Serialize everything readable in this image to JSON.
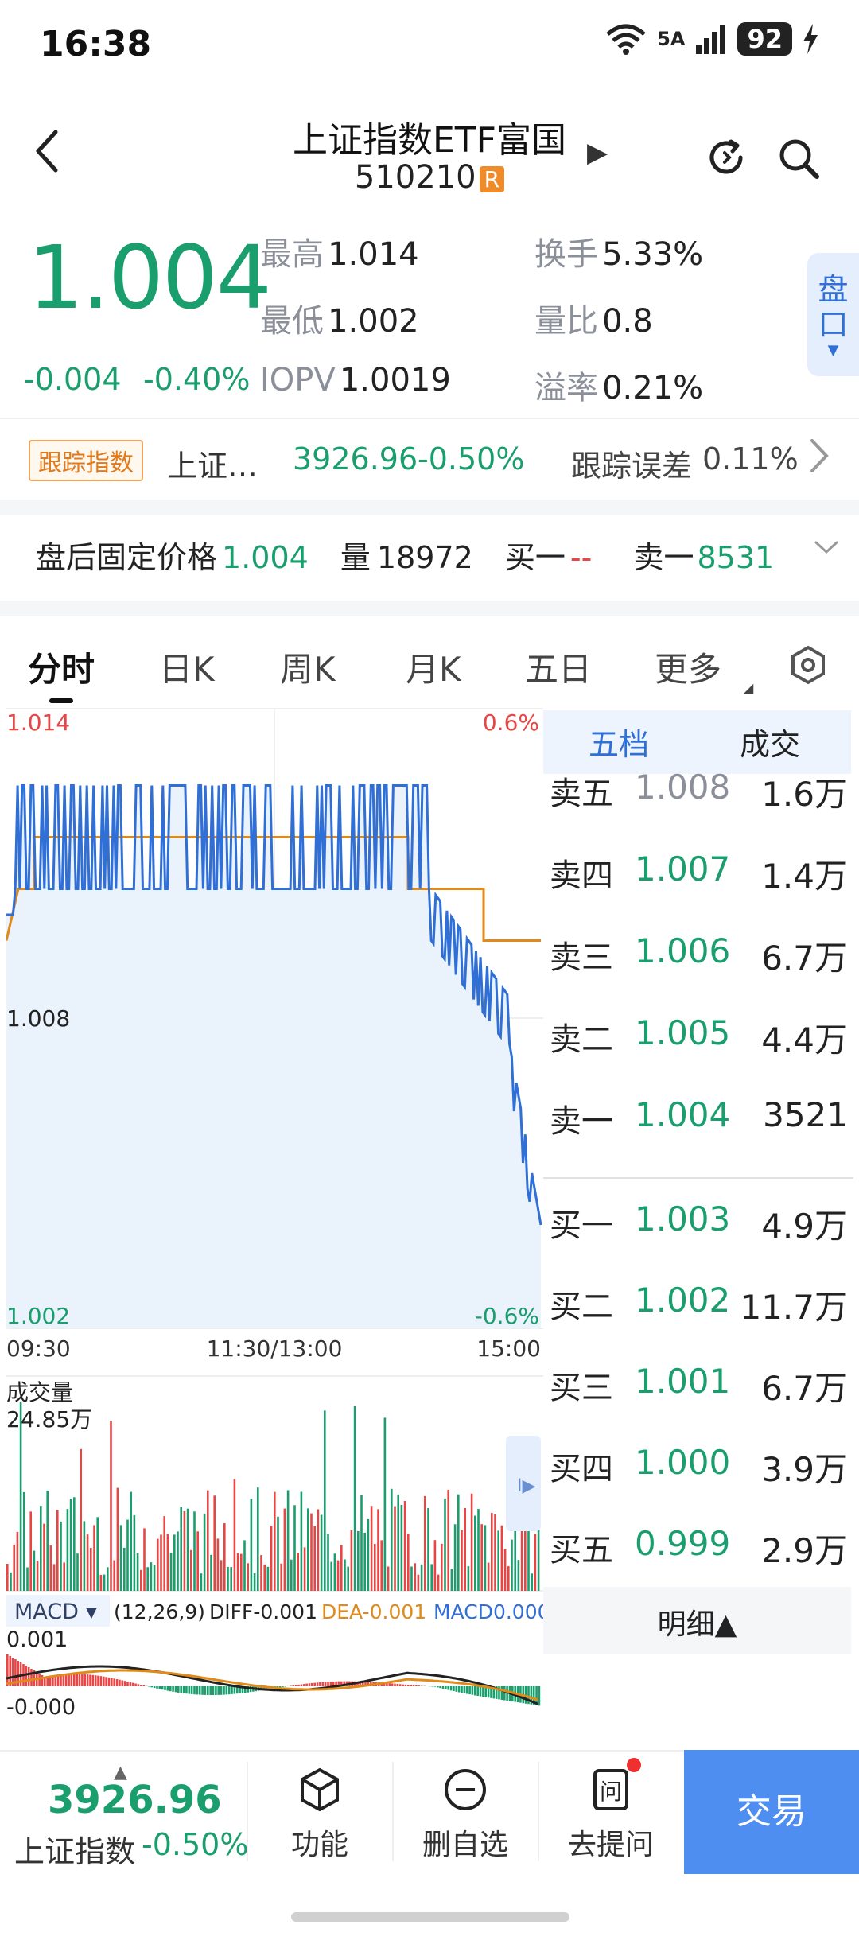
{
  "status_bar": {
    "time": "16:38",
    "signal_label": "5A",
    "battery": "92"
  },
  "header": {
    "title": "上证指数ETF富国",
    "code": "510210",
    "badge": "R"
  },
  "quote": {
    "price": "1.004",
    "change": "-0.004",
    "change_pct": "-0.40%",
    "high_label": "最高",
    "high": "1.014",
    "low_label": "最低",
    "low": "1.002",
    "iopv_label": "IOPV",
    "iopv": "1.0019",
    "turnover_label": "换手",
    "turnover": "5.33%",
    "volume_ratio_label": "量比",
    "volume_ratio": "0.8",
    "premium_label": "溢率",
    "premium": "0.21%",
    "pankou_label": "盘口"
  },
  "tracking": {
    "tag": "跟踪指数",
    "index_name": "上证…",
    "index_value": "3926.96",
    "index_pct": "-0.50%",
    "error_label": "跟踪误差",
    "error_value": "0.11%"
  },
  "after_hours": {
    "label": "盘后固定价格",
    "price": "1.004",
    "volume_label": "量",
    "volume": "18972",
    "buy1_label": "买一",
    "buy1": "--",
    "sell1_label": "卖一",
    "sell1": "8531"
  },
  "chart_tabs": [
    "分时",
    "日K",
    "周K",
    "月K",
    "五日",
    "更多"
  ],
  "intraday": {
    "y_top": "1.014",
    "y_mid": "1.008",
    "y_bottom": "1.002",
    "pct_top": "0.6%",
    "pct_bottom": "-0.6%",
    "x_labels": [
      "09:30",
      "11:30/13:00",
      "15:00"
    ],
    "volume_label": "成交量",
    "volume_max": "24.85万",
    "macd_label": "MACD",
    "macd_params": "(12,26,9)",
    "macd_diff": "DIFF-0.001",
    "macd_dea": "DEA-0.001",
    "macd_macd": "MACD0.000",
    "macd_top": "0.001",
    "macd_bottom": "-0.000",
    "colors": {
      "price": "#2f6fd6",
      "avg": "#e08a1a",
      "down": "#1a9e6e",
      "up": "#e84545"
    }
  },
  "order_book": {
    "tabs": [
      "五档",
      "成交"
    ],
    "sells": [
      {
        "label": "卖五",
        "price": "1.008",
        "vol": "1.6万"
      },
      {
        "label": "卖四",
        "price": "1.007",
        "vol": "1.4万"
      },
      {
        "label": "卖三",
        "price": "1.006",
        "vol": "6.7万"
      },
      {
        "label": "卖二",
        "price": "1.005",
        "vol": "4.4万"
      },
      {
        "label": "卖一",
        "price": "1.004",
        "vol": "3521"
      }
    ],
    "buys": [
      {
        "label": "买一",
        "price": "1.003",
        "vol": "4.9万"
      },
      {
        "label": "买二",
        "price": "1.002",
        "vol": "11.7万"
      },
      {
        "label": "买三",
        "price": "1.001",
        "vol": "6.7万"
      },
      {
        "label": "买四",
        "price": "1.000",
        "vol": "3.9万"
      },
      {
        "label": "买五",
        "price": "0.999",
        "vol": "2.9万"
      }
    ],
    "detail_label": "明细▲"
  },
  "bottom_bar": {
    "index_value": "3926.96",
    "index_name": "上证指数",
    "index_pct": "-0.50%",
    "func_label": "功能",
    "remove_label": "删自选",
    "ask_label": "去提问",
    "trade_label": "交易"
  }
}
